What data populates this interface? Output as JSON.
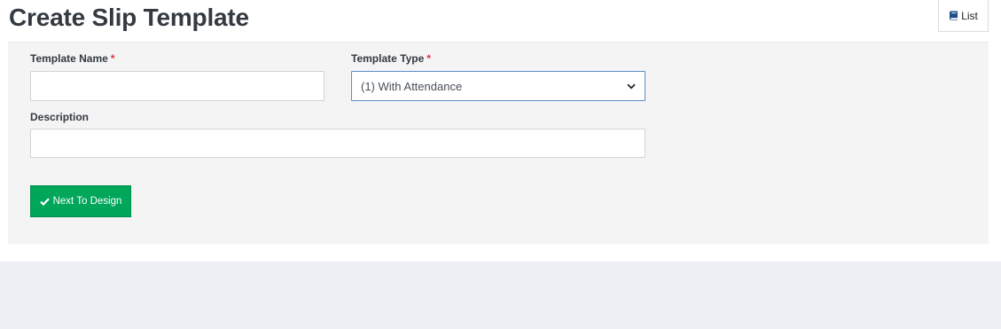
{
  "header": {
    "title": "Create Slip Template",
    "list_button_label": "List",
    "list_icon": "book-icon"
  },
  "form": {
    "template_name": {
      "label": "Template Name",
      "required_mark": "*",
      "value": ""
    },
    "template_type": {
      "label": "Template Type",
      "required_mark": "*",
      "selected": "(1) With Attendance",
      "icon": "chevron-down-icon"
    },
    "description": {
      "label": "Description",
      "value": ""
    },
    "next_button": {
      "label": "Next To Design",
      "icon": "check-icon"
    }
  },
  "colors": {
    "primary_button": "#00a65a",
    "required": "#dc3545",
    "card_background": "#f4f4f4",
    "select_focus_border": "#5b8fc7",
    "footer_background": "#eceff3"
  }
}
